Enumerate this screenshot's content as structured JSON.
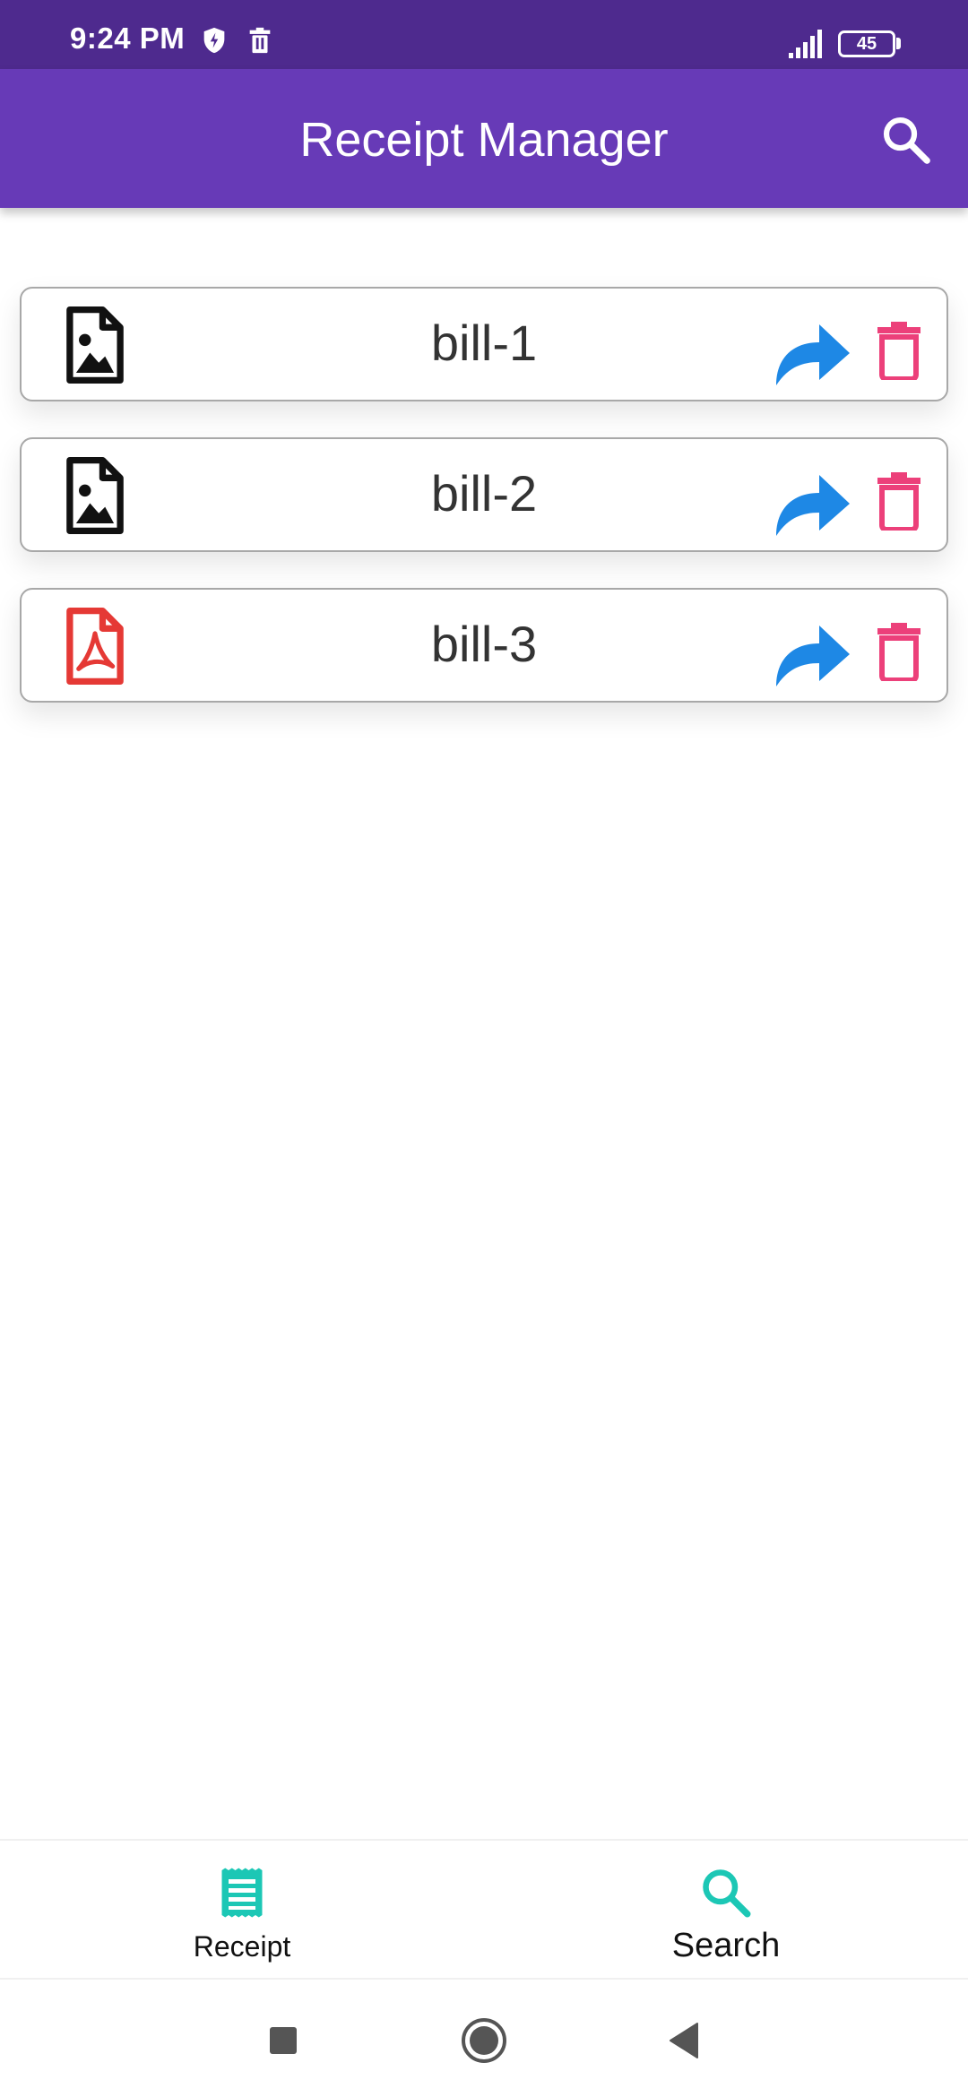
{
  "status_bar": {
    "time": "9:24 PM",
    "battery_level": "45",
    "icons": [
      "shield-bolt-icon",
      "trash-notification-icon",
      "signal-icon",
      "battery-icon"
    ]
  },
  "app_bar": {
    "title": "Receipt Manager",
    "action_icon": "search-icon"
  },
  "receipts": [
    {
      "name": "bill-1",
      "file_type": "image",
      "icon": "image-file-icon",
      "icon_color": "#111111"
    },
    {
      "name": "bill-2",
      "file_type": "image",
      "icon": "image-file-icon",
      "icon_color": "#111111"
    },
    {
      "name": "bill-3",
      "file_type": "pdf",
      "icon": "pdf-file-icon",
      "icon_color": "#e53935"
    }
  ],
  "actions": {
    "share_icon": "share-icon",
    "delete_icon": "trash-icon",
    "share_color": "#1e88e5",
    "delete_color": "#ec407a"
  },
  "bottom_nav": {
    "items": [
      {
        "label": "Receipt",
        "icon": "receipt-icon",
        "color": "#1cc7b5"
      },
      {
        "label": "Search",
        "icon": "search-icon",
        "color": "#1cc7b5"
      }
    ]
  },
  "system_nav": [
    "recents-button",
    "home-button",
    "back-button"
  ],
  "colors": {
    "status_bar": "#4e2a8e",
    "app_bar": "#673ab7",
    "accent": "#1cc7b5"
  }
}
